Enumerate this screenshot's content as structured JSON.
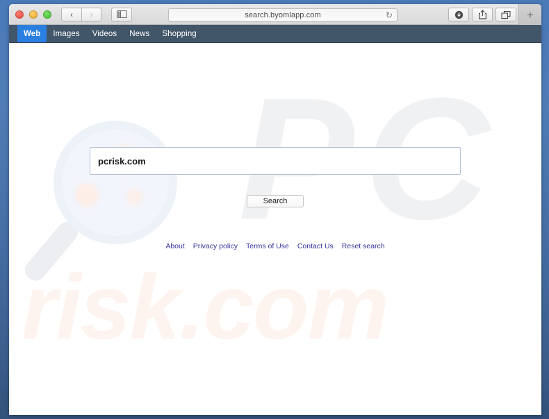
{
  "window": {
    "traffic_lights": [
      "close",
      "minimize",
      "maximize"
    ],
    "back_glyph": "‹",
    "forward_glyph": "›",
    "sidebar_icon": "sidebar-toggle-icon",
    "new_tab_label": "+",
    "reload_glyph": "↻",
    "toolbar_icons": [
      "download-icon",
      "share-icon",
      "tab-overview-icon"
    ]
  },
  "address_bar": {
    "url": "search.byomlapp.com",
    "placeholder": "Search or enter website name"
  },
  "site_nav": {
    "items": [
      {
        "label": "Web",
        "active": true
      },
      {
        "label": "Images",
        "active": false
      },
      {
        "label": "Videos",
        "active": false
      },
      {
        "label": "News",
        "active": false
      },
      {
        "label": "Shopping",
        "active": false
      }
    ],
    "active_color": "#2a7fe0",
    "bar_color": "#42566a"
  },
  "search": {
    "query_value": "pcrisk.com",
    "placeholder": "",
    "button_label": "Search"
  },
  "footer": {
    "links": [
      "About",
      "Privacy policy",
      "Terms of Use",
      "Contact Us",
      "Reset search"
    ],
    "link_color": "#34349b"
  },
  "watermarks": {
    "logo_text": "PC",
    "domain_text": "risk.com",
    "glass_icon": "magnifying-glass-icon"
  }
}
